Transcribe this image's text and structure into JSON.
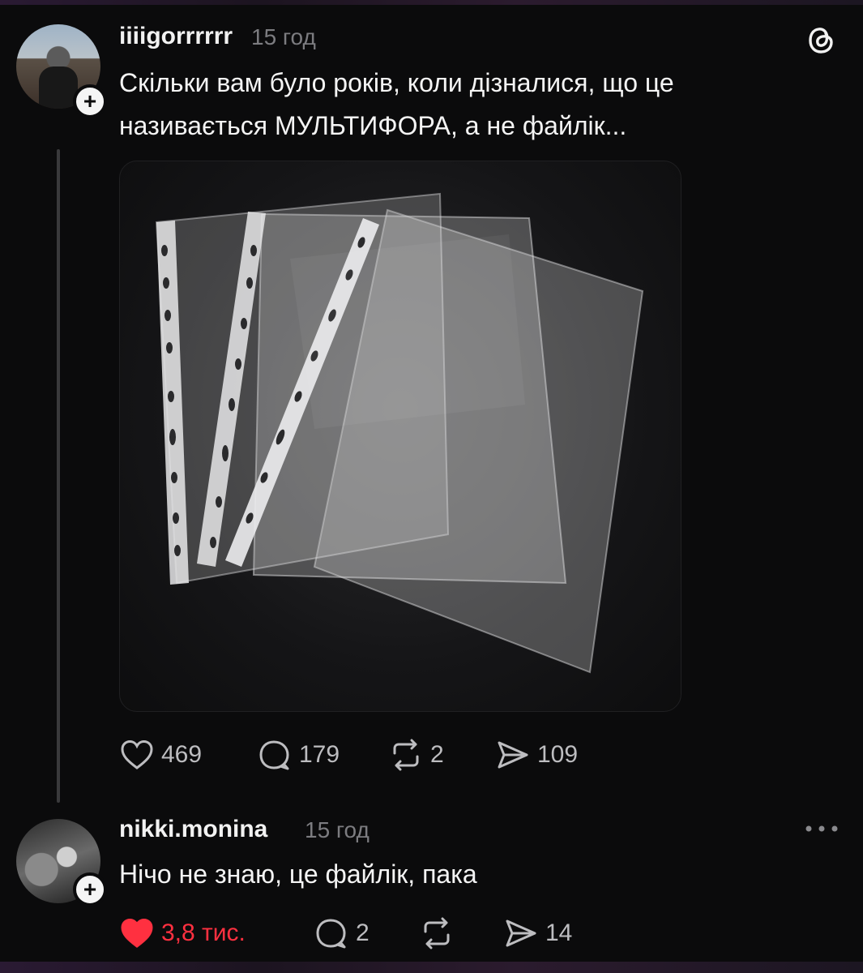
{
  "main_post": {
    "username": "iiiigorrrrrr",
    "time": "15 год",
    "text_line1": "Скільки вам було років, коли дізналися, що це",
    "text_line2": "називається МУЛЬТИФОРА, а не файлік...",
    "follow_badge": "+",
    "actions": {
      "likes": "469",
      "comments": "179",
      "reposts": "2",
      "shares": "109"
    }
  },
  "reply_post": {
    "username": "nikki.monina",
    "time": "15 год",
    "text": "Нічо не знаю, це файлік, пака",
    "follow_badge": "+",
    "liked": true,
    "actions": {
      "likes": "3,8 тис.",
      "comments": "2",
      "shares": "14"
    }
  },
  "icons": {
    "threads_logo": "threads-logo-icon",
    "more": "more-dots-icon",
    "like": "heart-icon",
    "comment": "comment-bubble-icon",
    "repost": "repost-icon",
    "share": "send-icon"
  },
  "colors": {
    "background": "#0b0b0c",
    "text": "#f2f2f2",
    "muted": "#7c7c80",
    "like_active": "#ff3040",
    "thread_line": "#3a3a3c"
  }
}
